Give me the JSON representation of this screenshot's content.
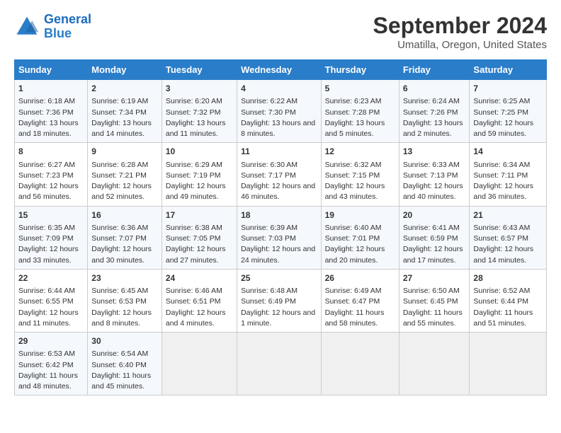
{
  "header": {
    "logo_line1": "General",
    "logo_line2": "Blue",
    "title": "September 2024",
    "subtitle": "Umatilla, Oregon, United States"
  },
  "days_of_week": [
    "Sunday",
    "Monday",
    "Tuesday",
    "Wednesday",
    "Thursday",
    "Friday",
    "Saturday"
  ],
  "weeks": [
    [
      {
        "day": "1",
        "info": "Sunrise: 6:18 AM\nSunset: 7:36 PM\nDaylight: 13 hours and 18 minutes."
      },
      {
        "day": "2",
        "info": "Sunrise: 6:19 AM\nSunset: 7:34 PM\nDaylight: 13 hours and 14 minutes."
      },
      {
        "day": "3",
        "info": "Sunrise: 6:20 AM\nSunset: 7:32 PM\nDaylight: 13 hours and 11 minutes."
      },
      {
        "day": "4",
        "info": "Sunrise: 6:22 AM\nSunset: 7:30 PM\nDaylight: 13 hours and 8 minutes."
      },
      {
        "day": "5",
        "info": "Sunrise: 6:23 AM\nSunset: 7:28 PM\nDaylight: 13 hours and 5 minutes."
      },
      {
        "day": "6",
        "info": "Sunrise: 6:24 AM\nSunset: 7:26 PM\nDaylight: 13 hours and 2 minutes."
      },
      {
        "day": "7",
        "info": "Sunrise: 6:25 AM\nSunset: 7:25 PM\nDaylight: 12 hours and 59 minutes."
      }
    ],
    [
      {
        "day": "8",
        "info": "Sunrise: 6:27 AM\nSunset: 7:23 PM\nDaylight: 12 hours and 56 minutes."
      },
      {
        "day": "9",
        "info": "Sunrise: 6:28 AM\nSunset: 7:21 PM\nDaylight: 12 hours and 52 minutes."
      },
      {
        "day": "10",
        "info": "Sunrise: 6:29 AM\nSunset: 7:19 PM\nDaylight: 12 hours and 49 minutes."
      },
      {
        "day": "11",
        "info": "Sunrise: 6:30 AM\nSunset: 7:17 PM\nDaylight: 12 hours and 46 minutes."
      },
      {
        "day": "12",
        "info": "Sunrise: 6:32 AM\nSunset: 7:15 PM\nDaylight: 12 hours and 43 minutes."
      },
      {
        "day": "13",
        "info": "Sunrise: 6:33 AM\nSunset: 7:13 PM\nDaylight: 12 hours and 40 minutes."
      },
      {
        "day": "14",
        "info": "Sunrise: 6:34 AM\nSunset: 7:11 PM\nDaylight: 12 hours and 36 minutes."
      }
    ],
    [
      {
        "day": "15",
        "info": "Sunrise: 6:35 AM\nSunset: 7:09 PM\nDaylight: 12 hours and 33 minutes."
      },
      {
        "day": "16",
        "info": "Sunrise: 6:36 AM\nSunset: 7:07 PM\nDaylight: 12 hours and 30 minutes."
      },
      {
        "day": "17",
        "info": "Sunrise: 6:38 AM\nSunset: 7:05 PM\nDaylight: 12 hours and 27 minutes."
      },
      {
        "day": "18",
        "info": "Sunrise: 6:39 AM\nSunset: 7:03 PM\nDaylight: 12 hours and 24 minutes."
      },
      {
        "day": "19",
        "info": "Sunrise: 6:40 AM\nSunset: 7:01 PM\nDaylight: 12 hours and 20 minutes."
      },
      {
        "day": "20",
        "info": "Sunrise: 6:41 AM\nSunset: 6:59 PM\nDaylight: 12 hours and 17 minutes."
      },
      {
        "day": "21",
        "info": "Sunrise: 6:43 AM\nSunset: 6:57 PM\nDaylight: 12 hours and 14 minutes."
      }
    ],
    [
      {
        "day": "22",
        "info": "Sunrise: 6:44 AM\nSunset: 6:55 PM\nDaylight: 12 hours and 11 minutes."
      },
      {
        "day": "23",
        "info": "Sunrise: 6:45 AM\nSunset: 6:53 PM\nDaylight: 12 hours and 8 minutes."
      },
      {
        "day": "24",
        "info": "Sunrise: 6:46 AM\nSunset: 6:51 PM\nDaylight: 12 hours and 4 minutes."
      },
      {
        "day": "25",
        "info": "Sunrise: 6:48 AM\nSunset: 6:49 PM\nDaylight: 12 hours and 1 minute."
      },
      {
        "day": "26",
        "info": "Sunrise: 6:49 AM\nSunset: 6:47 PM\nDaylight: 11 hours and 58 minutes."
      },
      {
        "day": "27",
        "info": "Sunrise: 6:50 AM\nSunset: 6:45 PM\nDaylight: 11 hours and 55 minutes."
      },
      {
        "day": "28",
        "info": "Sunrise: 6:52 AM\nSunset: 6:44 PM\nDaylight: 11 hours and 51 minutes."
      }
    ],
    [
      {
        "day": "29",
        "info": "Sunrise: 6:53 AM\nSunset: 6:42 PM\nDaylight: 11 hours and 48 minutes."
      },
      {
        "day": "30",
        "info": "Sunrise: 6:54 AM\nSunset: 6:40 PM\nDaylight: 11 hours and 45 minutes."
      },
      {
        "day": "",
        "info": ""
      },
      {
        "day": "",
        "info": ""
      },
      {
        "day": "",
        "info": ""
      },
      {
        "day": "",
        "info": ""
      },
      {
        "day": "",
        "info": ""
      }
    ]
  ]
}
